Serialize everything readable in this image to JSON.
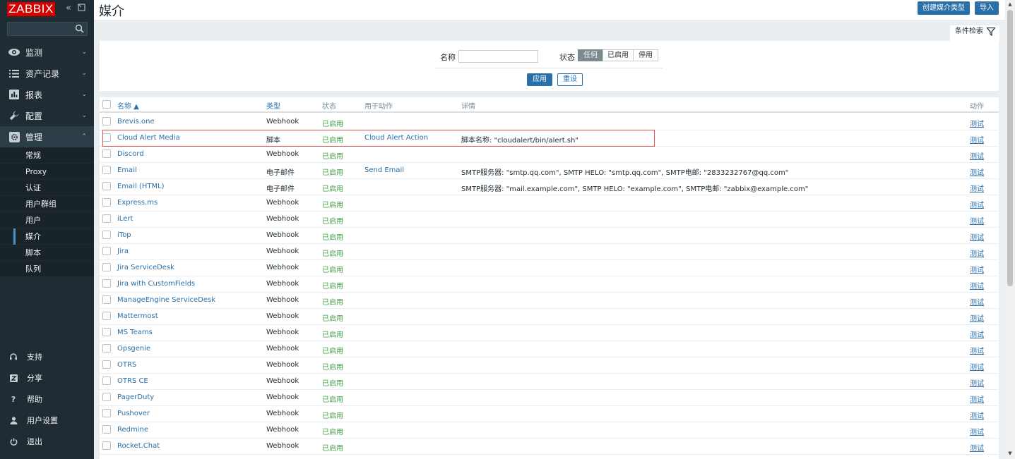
{
  "brand": {
    "logo_text": "ZABBIX",
    "color": "#d40000"
  },
  "sidebar": {
    "main_items": [
      {
        "label": "监测",
        "icon": "eye-icon"
      },
      {
        "label": "资产记录",
        "icon": "list-icon"
      },
      {
        "label": "报表",
        "icon": "bar-chart-icon"
      },
      {
        "label": "配置",
        "icon": "wrench-icon"
      },
      {
        "label": "管理",
        "icon": "gear-icon"
      }
    ],
    "admin_sub": [
      "常规",
      "Proxy",
      "认证",
      "用户群组",
      "用户",
      "媒介",
      "脚本",
      "队列"
    ],
    "selected_sub": "媒介",
    "bottom_items": [
      {
        "label": "支持",
        "icon": "headset-icon"
      },
      {
        "label": "分享",
        "icon": "share-icon"
      },
      {
        "label": "帮助",
        "icon": "help-icon"
      },
      {
        "label": "用户设置",
        "icon": "user-icon"
      },
      {
        "label": "退出",
        "icon": "power-icon"
      }
    ]
  },
  "header": {
    "title": "媒介",
    "create_button": "创建媒介类型",
    "import_button": "导入"
  },
  "filter": {
    "tab_label": "条件检索",
    "name_label": "名称",
    "name_value": "",
    "status_label": "状态",
    "status_options": [
      "任何",
      "已启用",
      "停用"
    ],
    "status_selected": "任何",
    "apply": "应用",
    "reset": "重设"
  },
  "table": {
    "columns": {
      "name": "名称 ▲",
      "type": "类型",
      "status": "状态",
      "used_in": "用于动作",
      "details": "详情",
      "action": "动作"
    },
    "rows": [
      {
        "name": "Brevis.one",
        "type": "Webhook",
        "status": "已启用",
        "used_in": "",
        "details": "",
        "action": "测试"
      },
      {
        "name": "Cloud Alert Media",
        "type": "脚本",
        "status": "已启用",
        "used_in": "Cloud Alert Action",
        "details": "脚本名称: \"cloudalert/bin/alert.sh\"",
        "action": "测试"
      },
      {
        "name": "Discord",
        "type": "Webhook",
        "status": "已启用",
        "used_in": "",
        "details": "",
        "action": "测试"
      },
      {
        "name": "Email",
        "type": "电子邮件",
        "status": "已启用",
        "used_in": "Send Email",
        "details": "SMTP服务器: \"smtp.qq.com\", SMTP HELO: \"smtp.qq.com\", SMTP电邮: \"2833232767@qq.com\"",
        "action": "测试"
      },
      {
        "name": "Email (HTML)",
        "type": "电子邮件",
        "status": "已启用",
        "used_in": "",
        "details": "SMTP服务器: \"mail.example.com\", SMTP HELO: \"example.com\", SMTP电邮: \"zabbix@example.com\"",
        "action": "测试"
      },
      {
        "name": "Express.ms",
        "type": "Webhook",
        "status": "已启用",
        "used_in": "",
        "details": "",
        "action": "测试"
      },
      {
        "name": "iLert",
        "type": "Webhook",
        "status": "已启用",
        "used_in": "",
        "details": "",
        "action": "测试"
      },
      {
        "name": "iTop",
        "type": "Webhook",
        "status": "已启用",
        "used_in": "",
        "details": "",
        "action": "测试"
      },
      {
        "name": "Jira",
        "type": "Webhook",
        "status": "已启用",
        "used_in": "",
        "details": "",
        "action": "测试"
      },
      {
        "name": "Jira ServiceDesk",
        "type": "Webhook",
        "status": "已启用",
        "used_in": "",
        "details": "",
        "action": "测试"
      },
      {
        "name": "Jira with CustomFields",
        "type": "Webhook",
        "status": "已启用",
        "used_in": "",
        "details": "",
        "action": "测试"
      },
      {
        "name": "ManageEngine ServiceDesk",
        "type": "Webhook",
        "status": "已启用",
        "used_in": "",
        "details": "",
        "action": "测试"
      },
      {
        "name": "Mattermost",
        "type": "Webhook",
        "status": "已启用",
        "used_in": "",
        "details": "",
        "action": "测试"
      },
      {
        "name": "MS Teams",
        "type": "Webhook",
        "status": "已启用",
        "used_in": "",
        "details": "",
        "action": "测试"
      },
      {
        "name": "Opsgenie",
        "type": "Webhook",
        "status": "已启用",
        "used_in": "",
        "details": "",
        "action": "测试"
      },
      {
        "name": "OTRS",
        "type": "Webhook",
        "status": "已启用",
        "used_in": "",
        "details": "",
        "action": "测试"
      },
      {
        "name": "OTRS CE",
        "type": "Webhook",
        "status": "已启用",
        "used_in": "",
        "details": "",
        "action": "测试"
      },
      {
        "name": "PagerDuty",
        "type": "Webhook",
        "status": "已启用",
        "used_in": "",
        "details": "",
        "action": "测试"
      },
      {
        "name": "Pushover",
        "type": "Webhook",
        "status": "已启用",
        "used_in": "",
        "details": "",
        "action": "测试"
      },
      {
        "name": "Redmine",
        "type": "Webhook",
        "status": "已启用",
        "used_in": "",
        "details": "",
        "action": "测试"
      },
      {
        "name": "Rocket.Chat",
        "type": "Webhook",
        "status": "已启用",
        "used_in": "",
        "details": "",
        "action": "测试"
      }
    ],
    "highlighted_row": "Cloud Alert Media"
  },
  "colors": {
    "sidebar_bg": "#1f2c33",
    "accent": "#2a6fa8",
    "enabled_green": "#429e47",
    "highlight_border": "#d9534f"
  }
}
